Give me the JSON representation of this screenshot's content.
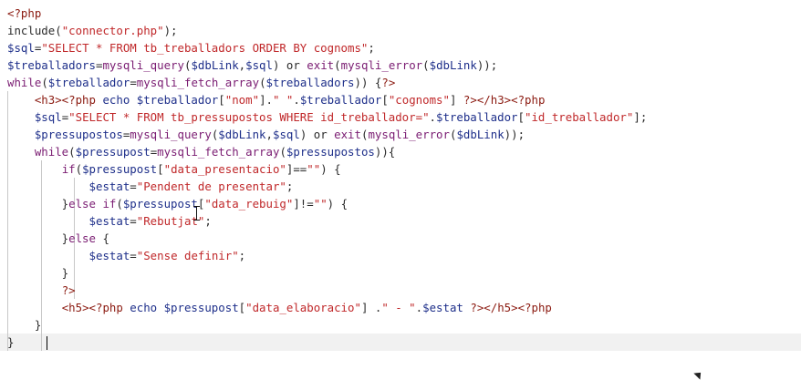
{
  "editor": {
    "lines": [
      [
        [
          "tag",
          "<?php"
        ]
      ],
      [
        [
          "default",
          "include("
        ],
        [
          "string",
          "\"connector.php\""
        ],
        [
          "default",
          ");"
        ]
      ],
      [
        [
          "var",
          "$sql"
        ],
        [
          "default",
          "="
        ],
        [
          "string",
          "\"SELECT * FROM tb_treballadors ORDER BY cognoms\""
        ],
        [
          "default",
          ";"
        ]
      ],
      [
        [
          "var",
          "$treballadors"
        ],
        [
          "default",
          "="
        ],
        [
          "keyword",
          "mysqli_query"
        ],
        [
          "default",
          "("
        ],
        [
          "var",
          "$dbLink"
        ],
        [
          "default",
          ","
        ],
        [
          "var",
          "$sql"
        ],
        [
          "default",
          ") or "
        ],
        [
          "keyword",
          "exit"
        ],
        [
          "default",
          "("
        ],
        [
          "keyword",
          "mysqli_error"
        ],
        [
          "default",
          "("
        ],
        [
          "var",
          "$dbLink"
        ],
        [
          "default",
          "));"
        ]
      ],
      [
        [
          "keyword",
          "while"
        ],
        [
          "default",
          "("
        ],
        [
          "var",
          "$treballador"
        ],
        [
          "default",
          "="
        ],
        [
          "keyword",
          "mysqli_fetch_array"
        ],
        [
          "default",
          "("
        ],
        [
          "var",
          "$treballadors"
        ],
        [
          "default",
          ")) {"
        ],
        [
          "tag",
          "?>"
        ]
      ],
      [
        [
          "default",
          "    "
        ],
        [
          "tag",
          "<h3><?php"
        ],
        [
          "text",
          " echo "
        ],
        [
          "var",
          "$treballador"
        ],
        [
          "default",
          "["
        ],
        [
          "string",
          "\"nom\""
        ],
        [
          "default",
          "]."
        ],
        [
          "string",
          "\" \""
        ],
        [
          "default",
          "."
        ],
        [
          "var",
          "$treballador"
        ],
        [
          "default",
          "["
        ],
        [
          "string",
          "\"cognoms\""
        ],
        [
          "default",
          "] "
        ],
        [
          "tag",
          "?></h3><?php"
        ]
      ],
      [
        [
          "default",
          "    "
        ],
        [
          "var",
          "$sql"
        ],
        [
          "default",
          "="
        ],
        [
          "string",
          "\"SELECT * FROM tb_pressupostos WHERE id_treballador=\""
        ],
        [
          "default",
          "."
        ],
        [
          "var",
          "$treballador"
        ],
        [
          "default",
          "["
        ],
        [
          "string",
          "\"id_treballador\""
        ],
        [
          "default",
          "];"
        ]
      ],
      [
        [
          "default",
          "    "
        ],
        [
          "var",
          "$pressupostos"
        ],
        [
          "default",
          "="
        ],
        [
          "keyword",
          "mysqli_query"
        ],
        [
          "default",
          "("
        ],
        [
          "var",
          "$dbLink"
        ],
        [
          "default",
          ","
        ],
        [
          "var",
          "$sql"
        ],
        [
          "default",
          ") or "
        ],
        [
          "keyword",
          "exit"
        ],
        [
          "default",
          "("
        ],
        [
          "keyword",
          "mysqli_error"
        ],
        [
          "default",
          "("
        ],
        [
          "var",
          "$dbLink"
        ],
        [
          "default",
          "));"
        ]
      ],
      [
        [
          "default",
          "    "
        ],
        [
          "keyword",
          "while"
        ],
        [
          "default",
          "("
        ],
        [
          "var",
          "$pressupost"
        ],
        [
          "default",
          "="
        ],
        [
          "keyword",
          "mysqli_fetch_array"
        ],
        [
          "default",
          "("
        ],
        [
          "var",
          "$pressupostos"
        ],
        [
          "default",
          ")){"
        ]
      ],
      [
        [
          "default",
          "        "
        ],
        [
          "keyword",
          "if"
        ],
        [
          "default",
          "("
        ],
        [
          "var",
          "$pressupost"
        ],
        [
          "default",
          "["
        ],
        [
          "string",
          "\"data_presentacio\""
        ],
        [
          "default",
          "]=="
        ],
        [
          "string",
          "\"\""
        ],
        [
          "default",
          ") {"
        ]
      ],
      [
        [
          "default",
          "            "
        ],
        [
          "var",
          "$estat"
        ],
        [
          "default",
          "="
        ],
        [
          "string",
          "\"Pendent de presentar\""
        ],
        [
          "default",
          ";"
        ]
      ],
      [
        [
          "default",
          "        }"
        ],
        [
          "keyword",
          "else if"
        ],
        [
          "default",
          "("
        ],
        [
          "var",
          "$pressupost"
        ],
        [
          "default",
          "["
        ],
        [
          "string",
          "\"data_rebuig\""
        ],
        [
          "default",
          "]!="
        ],
        [
          "string",
          "\"\""
        ],
        [
          "default",
          ") {"
        ]
      ],
      [
        [
          "default",
          "            "
        ],
        [
          "var",
          "$estat"
        ],
        [
          "default",
          "="
        ],
        [
          "string",
          "\"Rebutjat\""
        ],
        [
          "default",
          ";"
        ]
      ],
      [
        [
          "default",
          "        }"
        ],
        [
          "keyword",
          "else"
        ],
        [
          "default",
          " {"
        ]
      ],
      [
        [
          "default",
          "            "
        ],
        [
          "var",
          "$estat"
        ],
        [
          "default",
          "="
        ],
        [
          "string",
          "\"Sense definir\""
        ],
        [
          "default",
          ";"
        ]
      ],
      [
        [
          "default",
          "        }"
        ]
      ],
      [
        [
          "default",
          "        "
        ],
        [
          "tag",
          "?>"
        ]
      ],
      [
        [
          "default",
          "        "
        ],
        [
          "tag",
          "<h5><?php"
        ],
        [
          "text",
          " echo "
        ],
        [
          "var",
          "$pressupost"
        ],
        [
          "default",
          "["
        ],
        [
          "string",
          "\"data_elaboracio\""
        ],
        [
          "default",
          "] ."
        ],
        [
          "string",
          "\" - \""
        ],
        [
          "default",
          "."
        ],
        [
          "var",
          "$estat"
        ],
        [
          "default",
          " "
        ],
        [
          "tag",
          "?></h5><?php"
        ]
      ],
      [
        [
          "default",
          "    }"
        ]
      ],
      [
        [
          "default",
          "}"
        ]
      ]
    ],
    "colors": {
      "background": "#ffffff",
      "default": "#2b2b2b",
      "tag": "#8b1a10",
      "keyword": "#7a1c72",
      "variable": "#1e2f8a",
      "string": "#c0282a",
      "current_line": "#f1f1f1",
      "indent_guide": "#c8c8c8"
    },
    "caret_line": 19
  }
}
